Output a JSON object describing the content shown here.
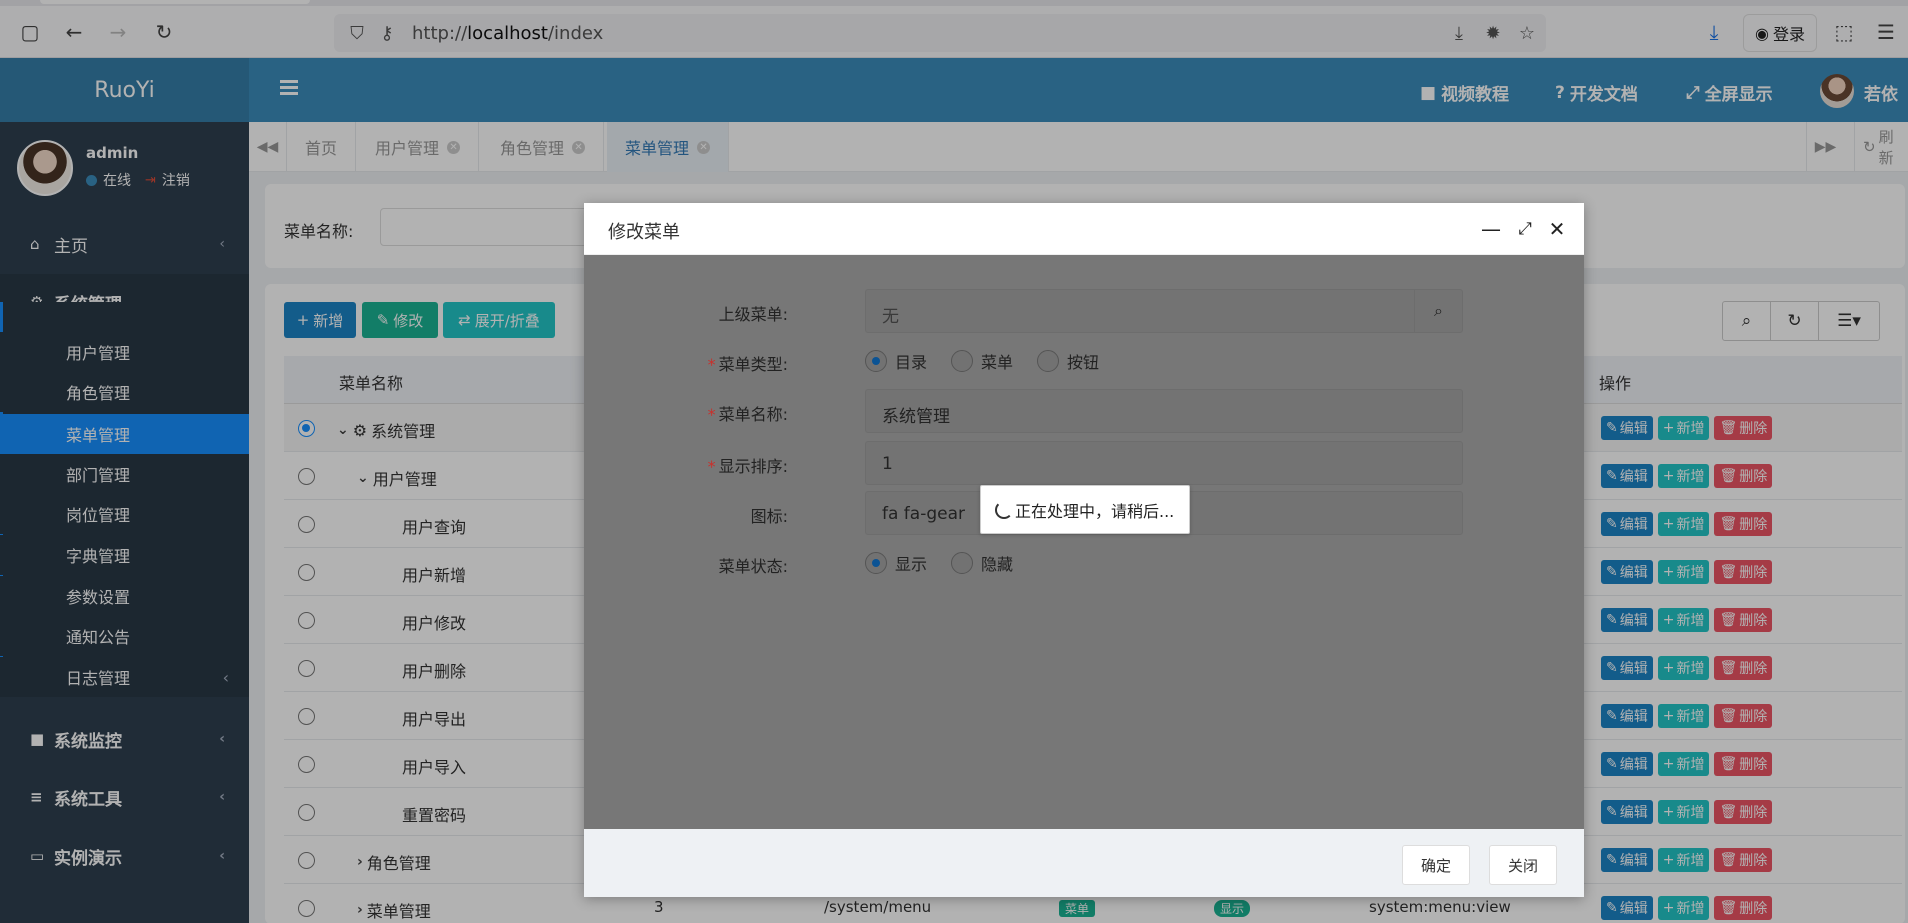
{
  "browser": {
    "url_prefix": "http://",
    "url_host": "localhost",
    "url_path": "/index",
    "login_label": "登录"
  },
  "header": {
    "logo": "RuoYi",
    "links": [
      {
        "icon": "video-icon",
        "label": "视频教程"
      },
      {
        "icon": "question-icon",
        "label": "开发文档"
      },
      {
        "icon": "expand-icon",
        "label": "全屏显示"
      }
    ],
    "user_name": "若依"
  },
  "sidebar": {
    "user": {
      "name": "admin",
      "status": "在线",
      "logout": "注销"
    },
    "items": [
      {
        "label": "主页",
        "icon": "home-icon"
      },
      {
        "label": "系统管理",
        "icon": "gear-icon"
      },
      {
        "label": "系统监控",
        "icon": "video-icon"
      },
      {
        "label": "系统工具",
        "icon": "bars-icon"
      },
      {
        "label": "实例演示",
        "icon": "desktop-icon"
      }
    ],
    "subitems": [
      "用户管理",
      "角色管理",
      "菜单管理",
      "部门管理",
      "岗位管理",
      "字典管理",
      "参数设置",
      "通知公告",
      "日志管理"
    ]
  },
  "tabs": {
    "items": [
      "首页",
      "用户管理",
      "角色管理",
      "菜单管理"
    ],
    "refresh": "刷新"
  },
  "search": {
    "menu_name_label": "菜单名称:"
  },
  "toolbar": {
    "add": "新增",
    "edit": "修改",
    "expand": "展开/折叠"
  },
  "table": {
    "col_name": "菜单名称",
    "col_ops": "操作",
    "rows": [
      {
        "name": "系统管理"
      },
      {
        "name": "用户管理"
      },
      {
        "name": "用户查询"
      },
      {
        "name": "用户新增"
      },
      {
        "name": "用户修改"
      },
      {
        "name": "用户删除"
      },
      {
        "name": "用户导出"
      },
      {
        "name": "用户导入"
      },
      {
        "name": "重置密码"
      },
      {
        "name": "角色管理"
      },
      {
        "name": "菜单管理",
        "order": "3",
        "url": "/system/menu",
        "type": "菜单",
        "visible": "显示",
        "perms": "system:menu:view"
      }
    ],
    "op_edit": "编辑",
    "op_add": "新增",
    "op_del": "删除"
  },
  "modal": {
    "title": "修改菜单",
    "parent_label": "上级菜单:",
    "parent_value": "无",
    "type_label": "菜单类型:",
    "type_options": [
      "目录",
      "菜单",
      "按钮"
    ],
    "type_selected": "目录",
    "name_label": "菜单名称:",
    "name_value": "系统管理",
    "order_label": "显示排序:",
    "order_value": "1",
    "icon_label": "图标:",
    "icon_value": "fa fa-gear",
    "status_label": "菜单状态:",
    "status_options": [
      "显示",
      "隐藏"
    ],
    "status_selected": "显示",
    "loading_text": "正在处理中，请稍后...",
    "confirm": "确定",
    "close": "关闭"
  }
}
